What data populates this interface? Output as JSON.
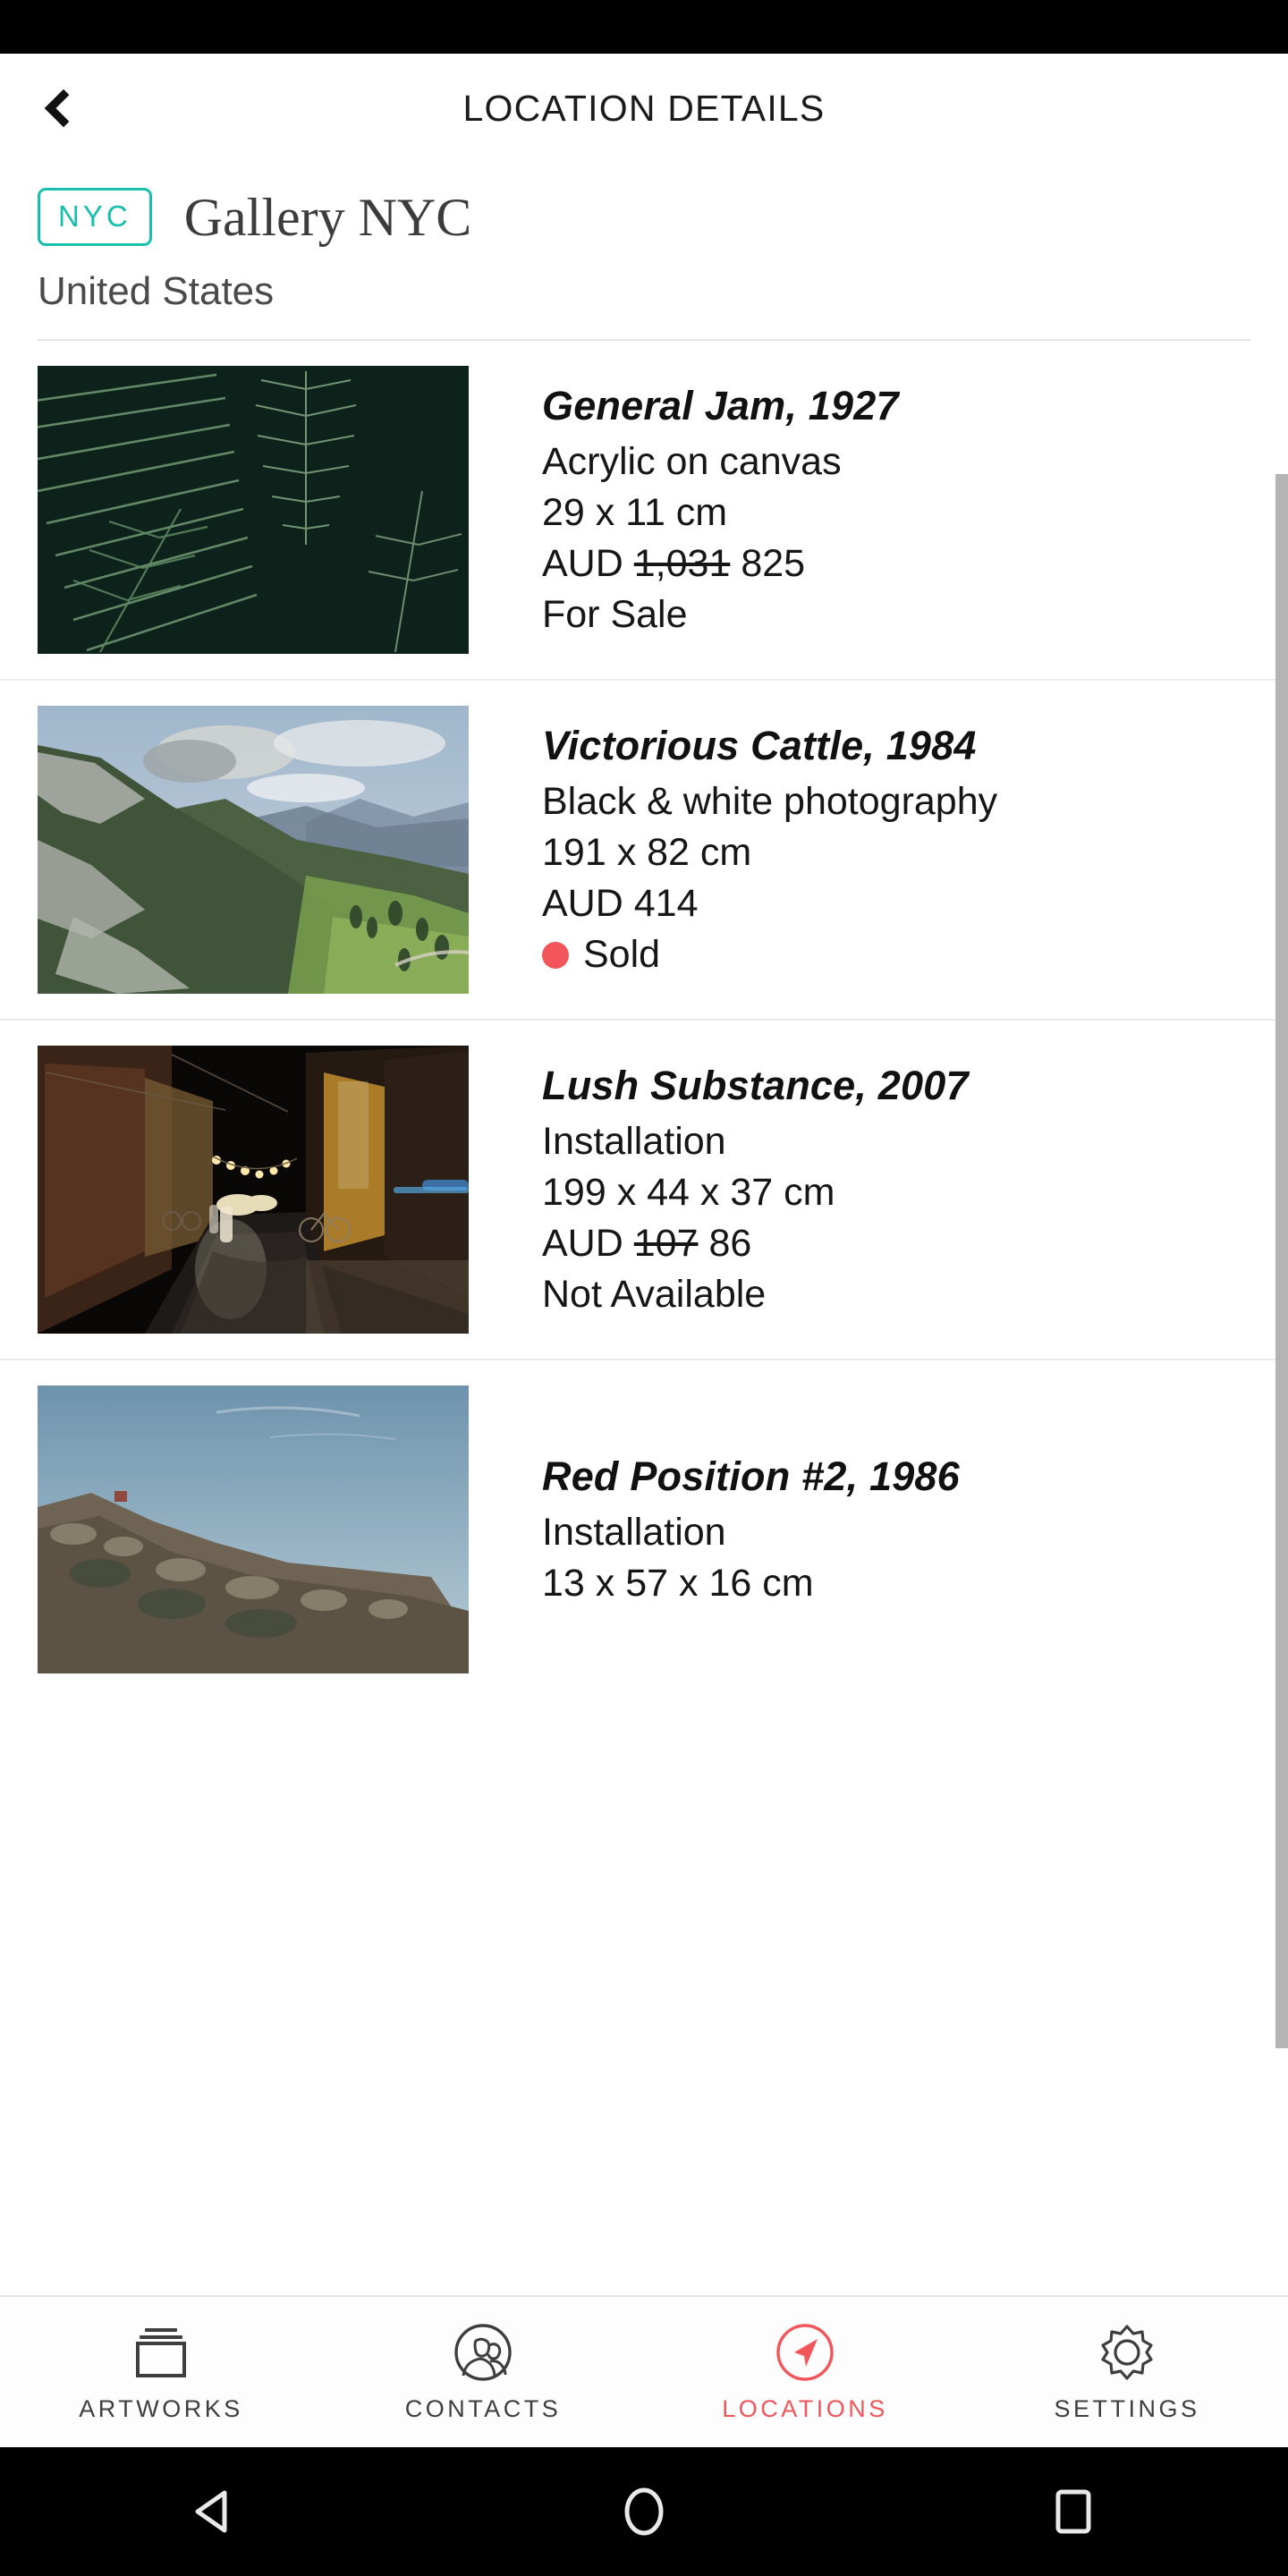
{
  "topbar": {
    "title": "LOCATION DETAILS",
    "back_icon": "chevron-left-icon"
  },
  "location": {
    "code": "NYC",
    "name": "Gallery NYC",
    "country": "United States",
    "code_color": "#19BFAE"
  },
  "artworks": [
    {
      "title": "General Jam, 1927",
      "medium": "Acrylic on canvas",
      "dimensions": "29 x 11 cm",
      "currency": "AUD",
      "old_price": "1,031",
      "price": "825",
      "status": "For Sale",
      "status_dot": false,
      "image": "fern-leaves-photo"
    },
    {
      "title": "Victorious Cattle, 1984",
      "medium": "Black & white photography",
      "dimensions": "191 x 82 cm",
      "currency": "AUD",
      "old_price": "",
      "price": "414",
      "status": "Sold",
      "status_dot": true,
      "status_dot_color": "#F2555A",
      "image": "mountain-valley-photo"
    },
    {
      "title": "Lush Substance, 2007",
      "medium": "Installation",
      "dimensions": "199 x 44 x 37 cm",
      "currency": "AUD",
      "old_price": "107",
      "price": "86",
      "status": "Not Available",
      "status_dot": false,
      "image": "night-street-photo"
    },
    {
      "title": "Red Position #2, 1986",
      "medium": "Installation",
      "dimensions": "13 x 57 x 16 cm",
      "currency": "AUD",
      "old_price": "",
      "price": "",
      "status": "",
      "status_dot": false,
      "image": "coastal-cliff-photo"
    }
  ],
  "tabbar": {
    "active_color": "#F2555A",
    "inactive_color": "#3E3E3E",
    "tabs": [
      {
        "label": "ARTWORKS",
        "icon": "frames-icon",
        "active": false
      },
      {
        "label": "CONTACTS",
        "icon": "people-circle-icon",
        "active": false
      },
      {
        "label": "LOCATIONS",
        "icon": "navigation-arrow-circle-icon",
        "active": true
      },
      {
        "label": "SETTINGS",
        "icon": "gear-icon",
        "active": false
      }
    ]
  },
  "android_nav": {
    "back": "triangle-back-icon",
    "home": "circle-home-icon",
    "recents": "square-recents-icon"
  }
}
